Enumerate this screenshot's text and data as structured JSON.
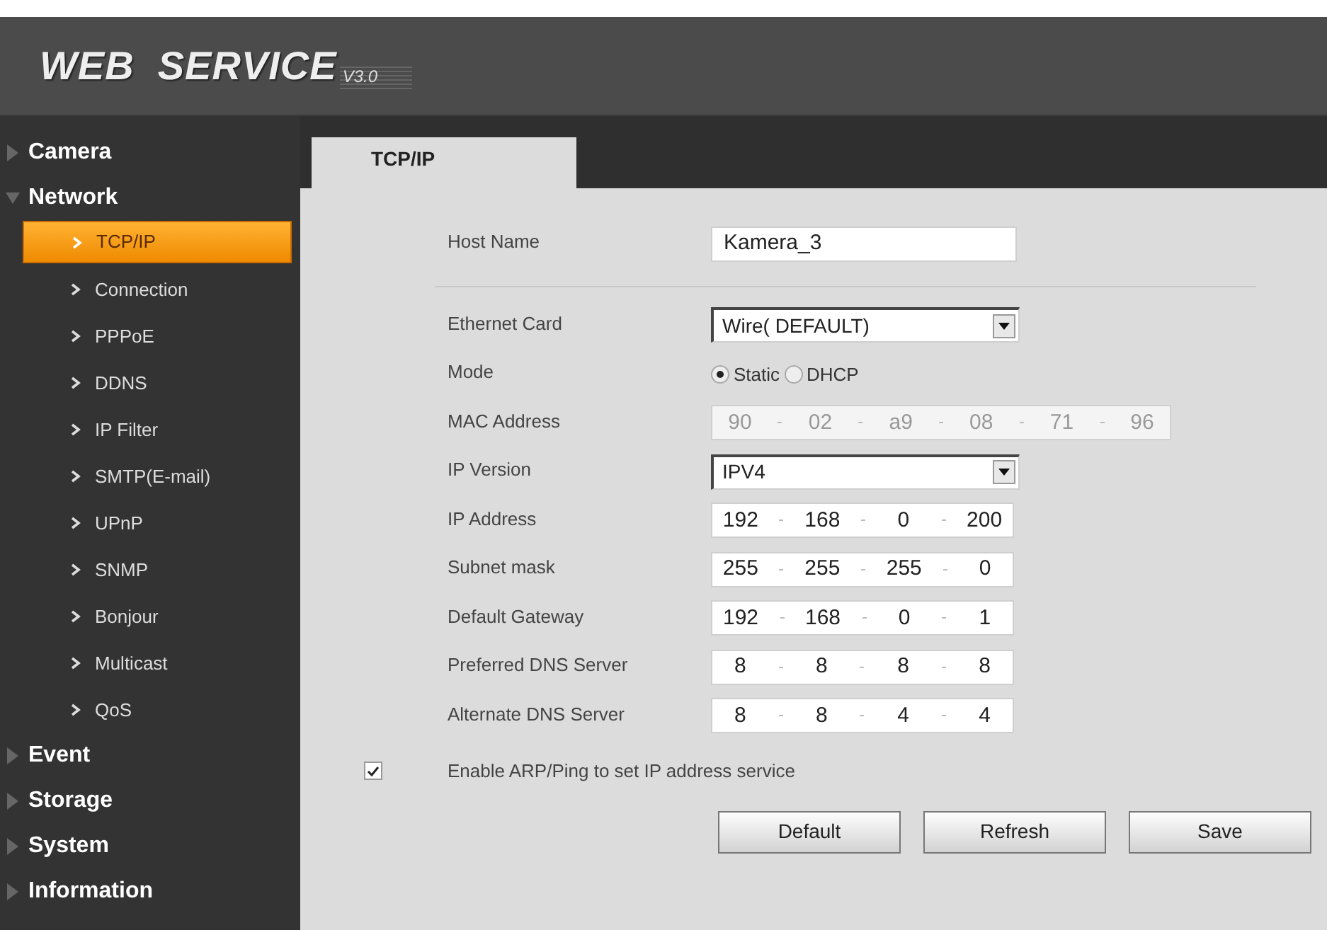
{
  "header": {
    "logo": "WEB  SERVICE",
    "version": "V3.0"
  },
  "sidebar": {
    "items": [
      {
        "label": "Camera",
        "expanded": false
      },
      {
        "label": "Network",
        "expanded": true,
        "children": [
          {
            "label": "TCP/IP",
            "selected": true
          },
          {
            "label": "Connection",
            "selected": false
          },
          {
            "label": "PPPoE",
            "selected": false
          },
          {
            "label": "DDNS",
            "selected": false
          },
          {
            "label": "IP Filter",
            "selected": false
          },
          {
            "label": "SMTP(E-mail)",
            "selected": false
          },
          {
            "label": "UPnP",
            "selected": false
          },
          {
            "label": "SNMP",
            "selected": false
          },
          {
            "label": "Bonjour",
            "selected": false
          },
          {
            "label": "Multicast",
            "selected": false
          },
          {
            "label": "QoS",
            "selected": false
          }
        ]
      },
      {
        "label": "Event",
        "expanded": false
      },
      {
        "label": "Storage",
        "expanded": false
      },
      {
        "label": "System",
        "expanded": false
      },
      {
        "label": "Information",
        "expanded": false
      }
    ]
  },
  "tabs": [
    {
      "label": "TCP/IP",
      "selected": true
    }
  ],
  "form": [
    {
      "kind": "text",
      "label": "Host Name",
      "value": "Kamera_3",
      "divider_after": true
    },
    {
      "kind": "select",
      "label": "Ethernet Card",
      "value": "Wire( DEFAULT)"
    },
    {
      "kind": "radio",
      "label": "Mode",
      "options": [
        {
          "label": "Static",
          "selected": true
        },
        {
          "label": "DHCP",
          "selected": false
        }
      ]
    },
    {
      "kind": "ip",
      "label": "MAC Address",
      "disabled": true,
      "octets": [
        "90",
        "02",
        "a9",
        "08",
        "71",
        "96"
      ]
    },
    {
      "kind": "select",
      "label": "IP Version",
      "value": "IPV4"
    },
    {
      "kind": "ip",
      "label": "IP Address",
      "disabled": false,
      "octets": [
        "192",
        "168",
        "0",
        "200"
      ]
    },
    {
      "kind": "ip",
      "label": "Subnet mask",
      "disabled": false,
      "octets": [
        "255",
        "255",
        "255",
        "0"
      ]
    },
    {
      "kind": "ip",
      "label": "Default Gateway",
      "disabled": false,
      "octets": [
        "192",
        "168",
        "0",
        "1"
      ]
    },
    {
      "kind": "ip",
      "label": "Preferred DNS Server",
      "disabled": false,
      "octets": [
        "8",
        "8",
        "8",
        "8"
      ]
    },
    {
      "kind": "ip",
      "label": "Alternate DNS Server",
      "disabled": false,
      "octets": [
        "8",
        "8",
        "4",
        "4"
      ]
    }
  ],
  "arp_checkbox": {
    "label": "Enable ARP/Ping to set IP address service",
    "checked": true
  },
  "buttons": [
    "Default",
    "Refresh",
    "Save"
  ]
}
